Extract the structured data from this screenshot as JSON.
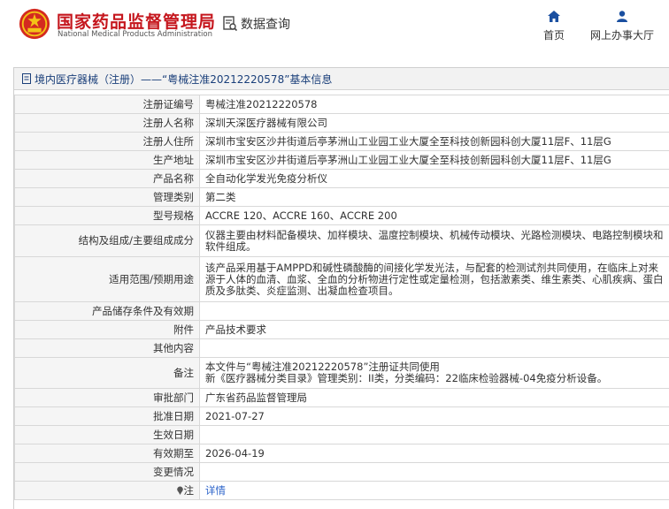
{
  "header": {
    "brand_cn": "国家药品监督管理局",
    "brand_en": "National Medical Products Administration",
    "query_label": "数据查询",
    "nav_home": "首页",
    "nav_online": "网上办事大厅",
    "icons": {
      "query": "document-search-icon",
      "home": "home-icon",
      "user": "user-icon"
    },
    "colors": {
      "brand": "#c5161d",
      "nav_icon": "#1a4fa0"
    }
  },
  "panel": {
    "title": "境内医疗器械（注册）——“粤械注准20212220578”基本信息"
  },
  "rows": [
    {
      "key": "注册证编号",
      "value": "粤械注准20212220578"
    },
    {
      "key": "注册人名称",
      "value": "深圳天深医疗器械有限公司"
    },
    {
      "key": "注册人住所",
      "value": "深圳市宝安区沙井街道后亭茅洲山工业园工业大厦全至科技创新园科创大厦11层F、11层G"
    },
    {
      "key": "生产地址",
      "value": "深圳市宝安区沙井街道后亭茅洲山工业园工业大厦全至科技创新园科创大厦11层F、11层G"
    },
    {
      "key": "产品名称",
      "value": "全自动化学发光免疫分析仪"
    },
    {
      "key": "管理类别",
      "value": "第二类"
    },
    {
      "key": "型号规格",
      "value": "ACCRE 120、ACCRE 160、ACCRE 200"
    },
    {
      "key": "结构及组成/主要组成成分",
      "value": "仪器主要由材料配备模块、加样模块、温度控制模块、机械传动模块、光路检测模块、电路控制模块和软件组成。"
    },
    {
      "key": "适用范围/预期用途",
      "value": "该产品采用基于AMPPD和碱性磷酸酶的间接化学发光法，与配套的检测试剂共同使用，在临床上对来源于人体的血清、血浆、全血的分析物进行定性或定量检测，包括激素类、维生素类、心肌疾病、蛋白质及多肽类、炎症监测、出凝血检查项目。"
    },
    {
      "key": "产品储存条件及有效期",
      "value": ""
    },
    {
      "key": "附件",
      "value": "产品技术要求"
    },
    {
      "key": "其他内容",
      "value": ""
    },
    {
      "key": "备注",
      "value_line1": "本文件与“粤械注准20212220578”注册证共同使用",
      "value_line2": "新《医疗器械分类目录》管理类别：II类，分类编码：22临床检验器械-04免疫分析设备。"
    },
    {
      "key": "审批部门",
      "value": "广东省药品监督管理局"
    },
    {
      "key": "批准日期",
      "value": "2021-07-27"
    },
    {
      "key": "生效日期",
      "value": ""
    },
    {
      "key": "有效期至",
      "value": "2026-04-19"
    },
    {
      "key": "变更情况",
      "value": ""
    },
    {
      "key": "注",
      "value": "详情"
    }
  ]
}
